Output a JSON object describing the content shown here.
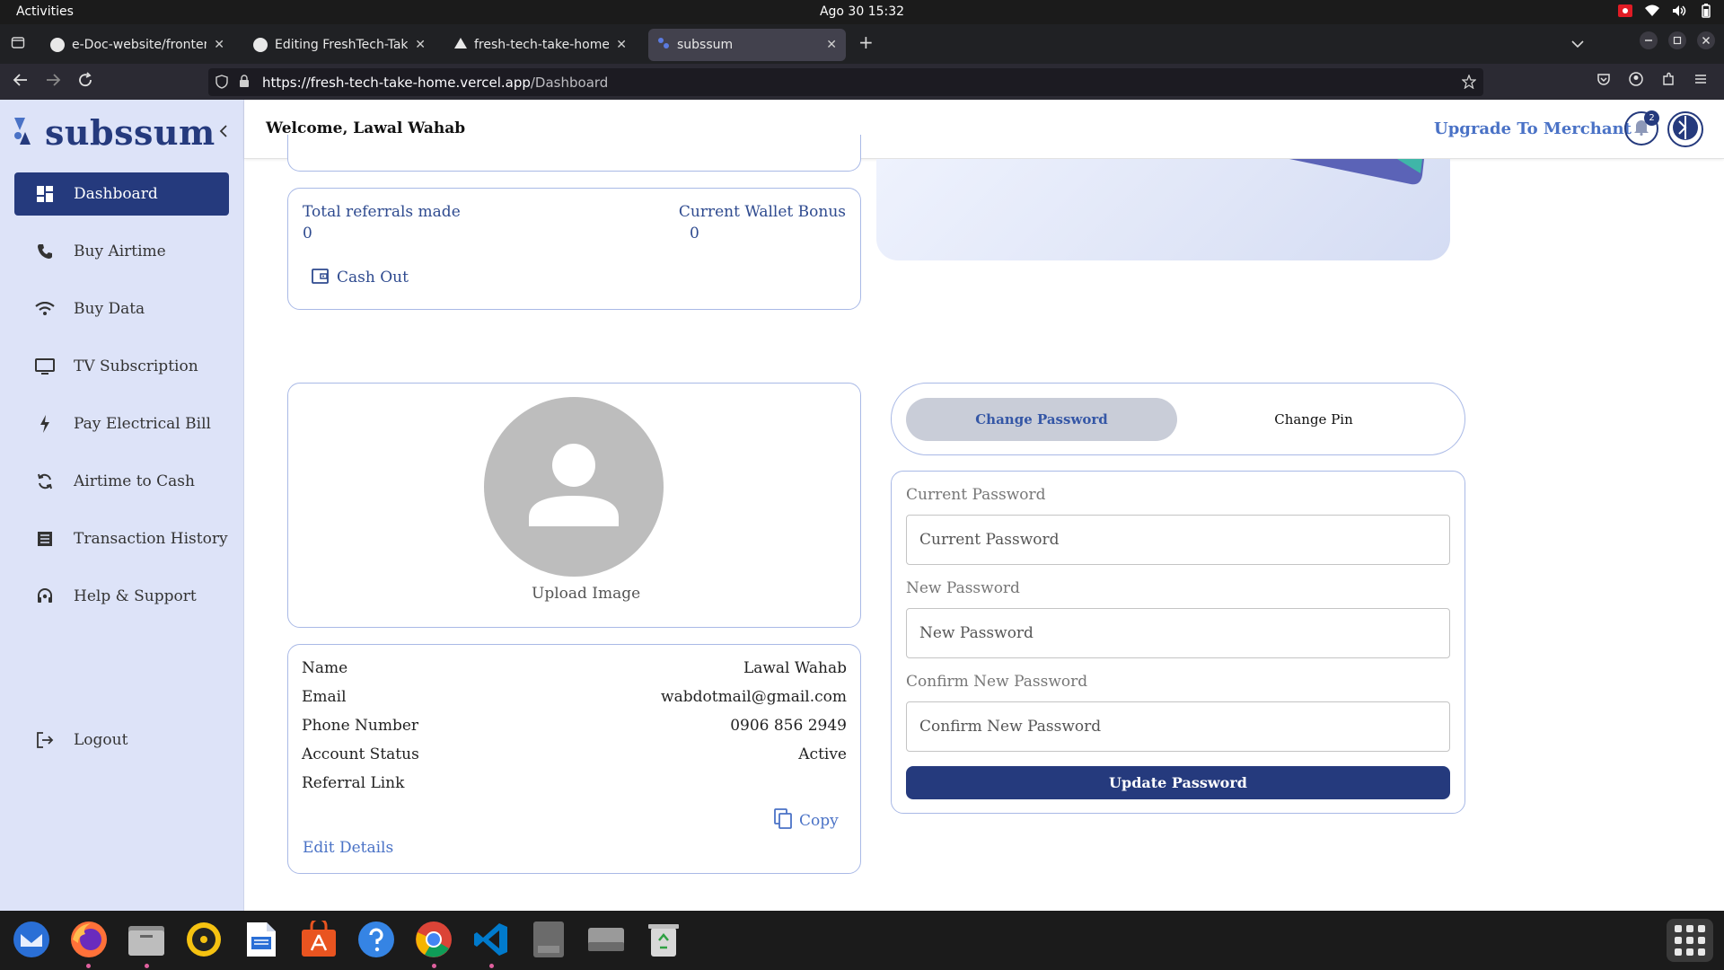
{
  "system_bar": {
    "activities": "Activities",
    "datetime": "Ago 30  15:32"
  },
  "browser": {
    "tabs": [
      {
        "title": "e-Doc-website/frontend/",
        "icon": "github-icon"
      },
      {
        "title": "Editing FreshTech-Take-H",
        "icon": "github-icon"
      },
      {
        "title": "fresh-tech-take-home - O",
        "icon": "vercel-icon"
      },
      {
        "title": "subssum",
        "icon": "subssum-icon"
      }
    ],
    "new_tab": "+",
    "url_host": "https://fresh-tech-take-home.vercel.app",
    "url_path": "/Dashboard"
  },
  "sidebar": {
    "brand": "subssum",
    "items": [
      {
        "label": "Dashboard",
        "icon": "dashboard-icon",
        "active": true
      },
      {
        "label": "Buy Airtime",
        "icon": "phone-icon"
      },
      {
        "label": "Buy Data",
        "icon": "wifi-icon"
      },
      {
        "label": "TV Subscription",
        "icon": "tv-icon"
      },
      {
        "label": "Pay Electrical Bill",
        "icon": "bolt-icon"
      },
      {
        "label": "Airtime to Cash",
        "icon": "refresh-icon"
      },
      {
        "label": "Transaction History",
        "icon": "list-icon"
      },
      {
        "label": "Help & Support",
        "icon": "headset-icon"
      }
    ],
    "logout": "Logout"
  },
  "header": {
    "welcome": "Welcome, Lawal Wahab",
    "upgrade": "Upgrade To Merchant",
    "notification_count": "2"
  },
  "referrals": {
    "total_label": "Total referrals made",
    "total_value": "0",
    "bonus_label": "Current Wallet Bonus",
    "bonus_value": "0",
    "cash_out": "Cash Out"
  },
  "profile": {
    "upload_label": "Upload Image",
    "rows": [
      {
        "label": "Name",
        "value": "Lawal Wahab"
      },
      {
        "label": "Email",
        "value": "wabdotmail@gmail.com"
      },
      {
        "label": "Phone Number",
        "value": "0906 856 2949"
      },
      {
        "label": "Account Status",
        "value": "Active"
      },
      {
        "label": "Referral Link",
        "value": ""
      }
    ],
    "copy": "Copy",
    "edit": "Edit Details"
  },
  "security": {
    "tab_password": "Change Password",
    "tab_pin": "Change Pin",
    "current_label": "Current Password",
    "current_placeholder": "Current Password",
    "new_label": "New Password",
    "new_placeholder": "New Password",
    "confirm_label": "Confirm New Password",
    "confirm_placeholder": "Confirm New Password",
    "submit": "Update Password"
  },
  "colors": {
    "brand_navy": "#253a7d",
    "sidebar_bg": "#dde3f8",
    "link_blue": "#4a72c6"
  }
}
